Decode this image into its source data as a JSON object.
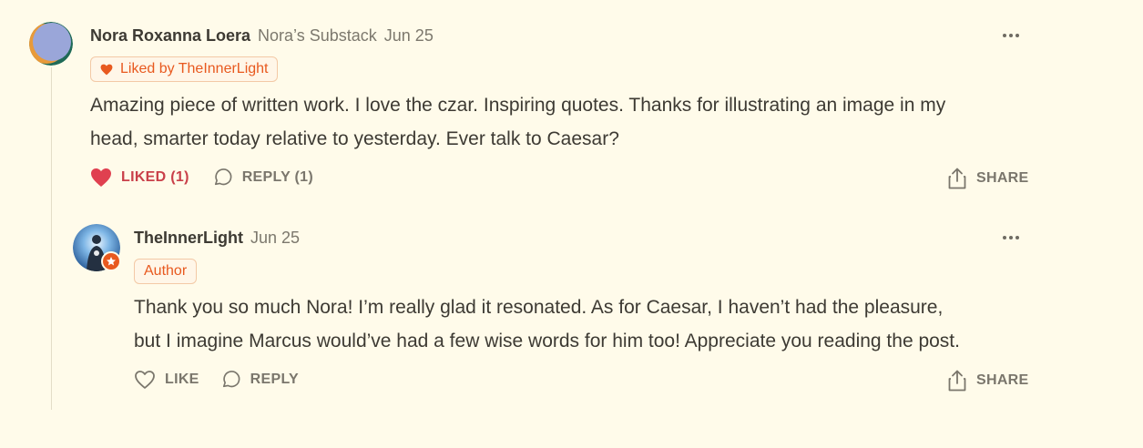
{
  "comment": {
    "author_name": "Nora Roxanna Loera",
    "publication": "Nora’s Substack",
    "date": "Jun 25",
    "liked_by_label": "Liked by TheInnerLight",
    "text": "Amazing piece of written work. I love the czar. Inspiring quotes. Thanks for illustrating an image in my head, smarter today relative to yesterday. Ever talk to Caesar?",
    "text_line1": "Amazing piece of written work. I love the czar. Inspiring quotes. Thanks for illustrating an image in my",
    "text_line2": "head, smarter today relative to yesterday. Ever talk to Caesar?",
    "like_label": "LIKED (1)",
    "reply_label": "REPLY (1)",
    "share_label": "SHARE",
    "like_color": "#e04050"
  },
  "reply": {
    "author_name": "TheInnerLight",
    "date": "Jun 25",
    "author_badge": "Author",
    "text_line1": "Thank you so much Nora! I’m really glad it resonated. As for Caesar, I haven’t had the pleasure,",
    "text_line2": "but I imagine Marcus would’ve had a few wise words for him too! Appreciate you reading the post.",
    "like_label": "LIKE",
    "reply_label": "REPLY",
    "share_label": "SHARE"
  },
  "colors": {
    "background": "#fffbea",
    "accent": "#e8591f",
    "liked": "#c9404a",
    "muted": "#7a766c"
  }
}
